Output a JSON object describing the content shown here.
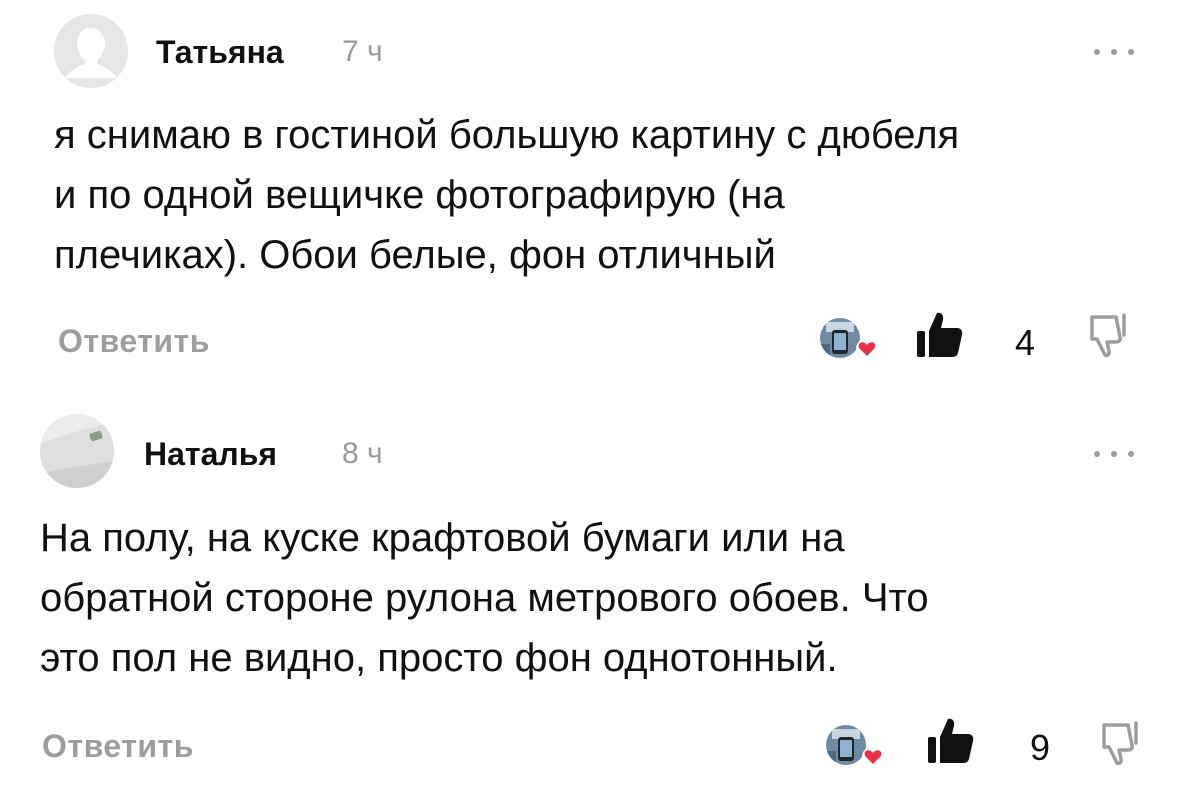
{
  "comments": [
    {
      "author": "Татьяна",
      "time": "7 ч",
      "text": "я снимаю в гостиной большую картину с дюбеля\nи по одной вещичке фотографирую (на\nплечиках). Обои белые, фон отличный",
      "reply_label": "Ответить",
      "likes": "4",
      "icons": {
        "more": "more-dots-icon",
        "like": "thumbs-up-icon",
        "dislike": "thumbs-down-icon",
        "reaction": "heart-icon"
      }
    },
    {
      "author": "Наталья",
      "time": "8 ч",
      "text": "На полу, на куске крафтовой бумаги или на\nобратной стороне рулона метрового обоев. Что\nэто пол не видно, просто фон однотонный.",
      "reply_label": "Ответить",
      "likes": "9",
      "icons": {
        "more": "more-dots-icon",
        "like": "thumbs-up-icon",
        "dislike": "thumbs-down-icon",
        "reaction": "heart-icon"
      }
    }
  ],
  "colors": {
    "heart": "#e8304a",
    "muted": "#9d9d9d",
    "text": "#111111"
  }
}
